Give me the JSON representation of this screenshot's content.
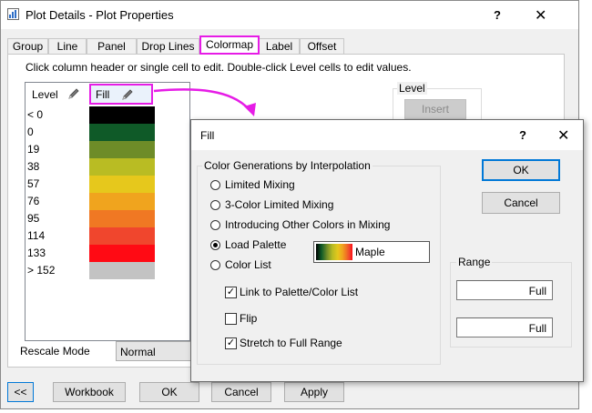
{
  "main_window": {
    "title": "Plot Details - Plot Properties",
    "help_glyph": "?",
    "close_glyph": "✕",
    "tabs": [
      "Group",
      "Line",
      "Panel",
      "Drop Lines",
      "Colormap",
      "Label",
      "Offset"
    ],
    "active_tab": "Colormap",
    "instruction": "Click column header or single cell to edit. Double-click Level cells to edit values.",
    "colormap": {
      "level_header": "Level",
      "fill_header": "Fill",
      "rows": [
        {
          "level": "< 0",
          "color": "#000000"
        },
        {
          "level": "0",
          "color": "#0f5a28"
        },
        {
          "level": "19",
          "color": "#6e8c28"
        },
        {
          "level": "38",
          "color": "#b9bc23"
        },
        {
          "level": "57",
          "color": "#e6c81c"
        },
        {
          "level": "76",
          "color": "#f0a41e"
        },
        {
          "level": "95",
          "color": "#f07823"
        },
        {
          "level": "114",
          "color": "#f0462d"
        },
        {
          "level": "133",
          "color": "#ff0a14"
        },
        {
          "level": "> 152",
          "color": "#c3c3c3"
        }
      ]
    },
    "level_group_title": "Level",
    "insert_button": "Insert",
    "rescale_mode_label": "Rescale Mode",
    "rescale_mode_value": "Normal",
    "buttons": {
      "collapse": "<<",
      "workbook": "Workbook",
      "ok": "OK",
      "cancel": "Cancel",
      "apply": "Apply"
    }
  },
  "fill_dialog": {
    "title": "Fill",
    "help_glyph": "?",
    "close_glyph": "✕",
    "group_title": "Color Generations by Interpolation",
    "options": [
      {
        "label": "Limited Mixing",
        "selected": false
      },
      {
        "label": "3-Color Limited Mixing",
        "selected": false
      },
      {
        "label": "Introducing Other Colors in Mixing",
        "selected": false
      },
      {
        "label": "Load Palette",
        "selected": true
      },
      {
        "label": "Color List",
        "selected": false
      }
    ],
    "palette_name": "Maple",
    "checkboxes": [
      {
        "label": "Link to Palette/Color List",
        "checked": true
      },
      {
        "label": "Flip",
        "checked": false
      },
      {
        "label": "Stretch to Full Range",
        "checked": true
      }
    ],
    "ok": "OK",
    "cancel": "Cancel",
    "range_title": "Range",
    "range_from": "Full",
    "range_to": "Full"
  },
  "colors": {
    "highlight": "#e61ce6",
    "dialog_bg": "#f0f0f0",
    "ok_border": "#0078d7"
  }
}
